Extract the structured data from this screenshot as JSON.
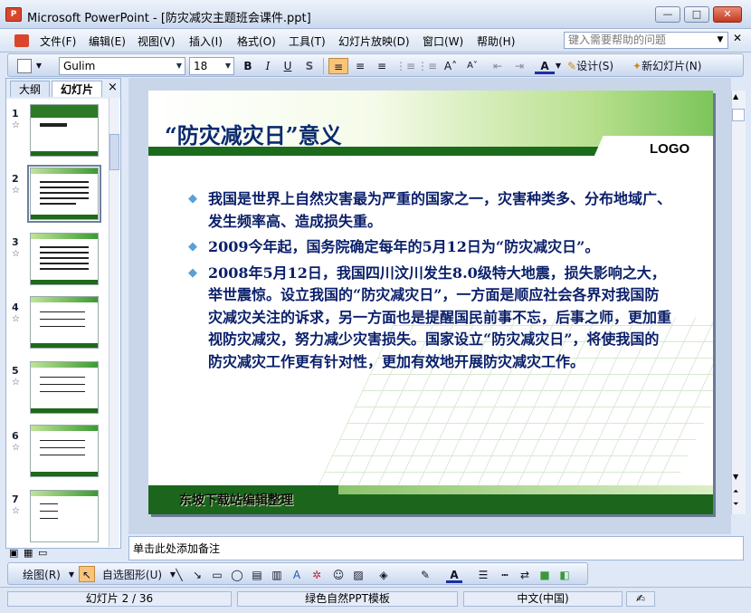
{
  "window": {
    "title": "Microsoft PowerPoint - [防灾减灾主题班会课件.ppt]",
    "app_icon": "P"
  },
  "winbtns": {
    "min": "—",
    "max": "□",
    "close": "✕"
  },
  "menus": [
    "文件(F)",
    "编辑(E)",
    "视图(V)",
    "插入(I)",
    "格式(O)",
    "工具(T)",
    "幻灯片放映(D)",
    "窗口(W)",
    "帮助(H)"
  ],
  "help": {
    "placeholder": "键入需要帮助的问题"
  },
  "toolbar": {
    "font": "Gulim",
    "size": "18",
    "bold": "B",
    "italic": "I",
    "underline": "U",
    "shadow": "S",
    "design": "设计(S)",
    "new_slide": "新幻灯片(N)"
  },
  "panel": {
    "tab_outline": "大纲",
    "tab_slides": "幻灯片",
    "close": "×"
  },
  "thumbs": [
    {
      "n": "1"
    },
    {
      "n": "2"
    },
    {
      "n": "3"
    },
    {
      "n": "4"
    },
    {
      "n": "5"
    },
    {
      "n": "6"
    },
    {
      "n": "7"
    }
  ],
  "slide": {
    "title": "“防灾减灾日”意义",
    "logo": "LOGO",
    "bullets": [
      "我国是世界上自然灾害最为严重的国家之一，灾害种类多、分布地域广、发生频率高、造成损失重。",
      "2009今年起，国务院确定每年的5月12日为“防灾减灾日”。",
      "2008年5月12日，我国四川汶川发生8.0级特大地震，损失影响之大，举世震惊。设立我国的“防灾减灾日”，一方面是顺应社会各界对我国防灾减灾关注的诉求，另一方面也是提醒国民前事不忘，后事之师，更加重视防灾减灾，努力减少灾害损失。国家设立“防灾减灾日”，将使我国的防灾减灾工作更有针对性，更加有效地开展防灾减灾工作。"
    ],
    "footer": "东坡下载站编辑整理"
  },
  "notes": {
    "text": "单击此处添加备注"
  },
  "drawbar": {
    "draw": "绘图(R)",
    "autoshapes": "自选图形(U)"
  },
  "status": {
    "slide": "幻灯片 2 / 36",
    "template": "绿色自然PPT模板",
    "lang": "中文(中国)"
  }
}
